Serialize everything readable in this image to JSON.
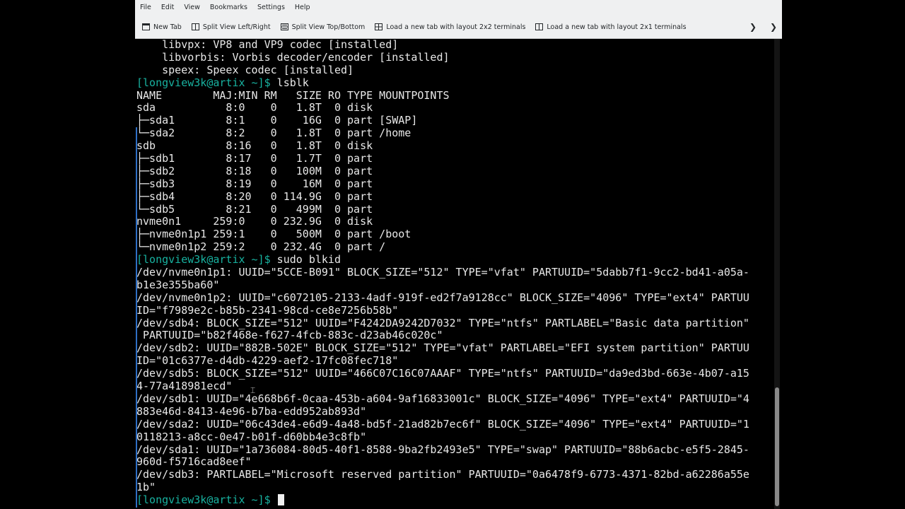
{
  "menubar": [
    "File",
    "Edit",
    "View",
    "Bookmarks",
    "Settings",
    "Help"
  ],
  "toolbar": {
    "new_tab": "New Tab",
    "split_lr": "Split View Left/Right",
    "split_tb": "Split View Top/Bottom",
    "layout_2x2": "Load a new tab with layout 2x2 terminals",
    "layout_2x1": "Load a new tab with layout 2x1 terminals",
    "overflow_icon": "chevron-right-icon"
  },
  "terminal": {
    "prompt": "[longview3k@artix ~]$",
    "lines": [
      "    libvpx: VP8 and VP9 codec [installed]",
      "    libvorbis: Vorbis decoder/encoder [installed]",
      "    speex: Speex codec [installed]",
      {
        "prompt": "[longview3k@artix ~]$",
        "cmd": " lsblk"
      },
      "NAME        MAJ:MIN RM   SIZE RO TYPE MOUNTPOINTS",
      "sda           8:0    0   1.8T  0 disk",
      "├─sda1        8:1    0    16G  0 part [SWAP]",
      "└─sda2        8:2    0   1.8T  0 part /home",
      "sdb           8:16   0   1.8T  0 disk",
      "├─sdb1        8:17   0   1.7T  0 part",
      "├─sdb2        8:18   0   100M  0 part",
      "├─sdb3        8:19   0    16M  0 part",
      "├─sdb4        8:20   0 114.9G  0 part",
      "└─sdb5        8:21   0   499M  0 part",
      "nvme0n1     259:0    0 232.9G  0 disk",
      "├─nvme0n1p1 259:1    0   500M  0 part /boot",
      "└─nvme0n1p2 259:2    0 232.4G  0 part /",
      {
        "prompt": "[longview3k@artix ~]$",
        "cmd": " sudo blkid"
      },
      "/dev/nvme0n1p1: UUID=\"5CCE-B091\" BLOCK_SIZE=\"512\" TYPE=\"vfat\" PARTUUID=\"5dabb7f1-9cc2-bd41-a05a-",
      "b1e3e355ba60\"",
      "/dev/nvme0n1p2: UUID=\"c6072105-2133-4adf-919f-ed2f7a9128cc\" BLOCK_SIZE=\"4096\" TYPE=\"ext4\" PARTUU",
      "ID=\"f7989e2c-b85b-2341-98cd-ce8e7256b58b\"",
      "/dev/sdb4: BLOCK_SIZE=\"512\" UUID=\"F4242DA9242D7032\" TYPE=\"ntfs\" PARTLABEL=\"Basic data partition\"",
      " PARTUUID=\"b82f468e-f627-4fcb-883c-d23ab46c020c\"",
      "/dev/sdb2: UUID=\"882B-502E\" BLOCK_SIZE=\"512\" TYPE=\"vfat\" PARTLABEL=\"EFI system partition\" PARTUU",
      "ID=\"01c6377e-d4db-4229-aef2-17fc08fec718\"",
      "/dev/sdb5: BLOCK_SIZE=\"512\" UUID=\"466C07C16C07AAAF\" TYPE=\"ntfs\" PARTUUID=\"da9ed3bd-663e-4b07-a15",
      "4-77a418981ecd\"",
      "/dev/sdb1: UUID=\"4e668b6f-0caa-453b-a604-9af16833001c\" BLOCK_SIZE=\"4096\" TYPE=\"ext4\" PARTUUID=\"4",
      "883e46d-8413-4e96-b7ba-edd952ab893d\"",
      "/dev/sda2: UUID=\"06c43de4-e6d9-4a48-bd5f-21ad82b7ec6f\" BLOCK_SIZE=\"4096\" TYPE=\"ext4\" PARTUUID=\"1",
      "0118213-a8cc-0e47-b01f-d60bb4e3c8fb\"",
      "/dev/sda1: UUID=\"1a736084-80d5-40f1-8588-9ba2fb2493e5\" TYPE=\"swap\" PARTUUID=\"88b6acbc-e5f5-2845-",
      "960d-f5716cad8eef\"",
      "/dev/sdb3: PARTLABEL=\"Microsoft reserved partition\" PARTUUID=\"0a6478f9-6773-4371-82bd-a62286a55e",
      "1b\"",
      {
        "prompt": "[longview3k@artix ~]$",
        "cmd": " ",
        "cursor": true
      }
    ]
  },
  "colors": {
    "prompt": "#18b2a0",
    "text": "#e8e8e8",
    "chrome": "#eff0f1"
  }
}
